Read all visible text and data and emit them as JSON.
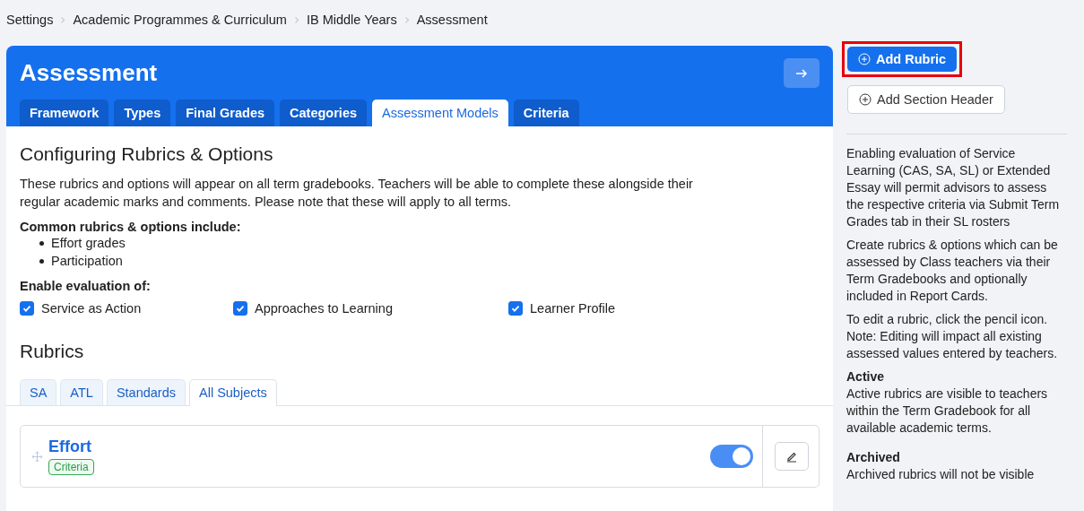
{
  "breadcrumb": [
    "Settings",
    "Academic Programmes & Curriculum",
    "IB Middle Years",
    "Assessment"
  ],
  "page": {
    "title": "Assessment",
    "tabs": [
      {
        "label": "Framework",
        "selected": false
      },
      {
        "label": "Types",
        "selected": false
      },
      {
        "label": "Final Grades",
        "selected": false
      },
      {
        "label": "Categories",
        "selected": false
      },
      {
        "label": "Assessment Models",
        "selected": true
      },
      {
        "label": "Criteria",
        "selected": false
      }
    ]
  },
  "section": {
    "heading": "Configuring Rubrics & Options",
    "intro": "These rubrics and options will appear on all term gradebooks. Teachers will be able to complete these alongside their regular academic marks and comments. Please note that these will apply to all terms.",
    "common_heading": "Common rubrics & options include:",
    "common_items": [
      "Effort grades",
      "Participation"
    ],
    "enable_heading": "Enable evaluation of:",
    "options": [
      {
        "label": "Service as Action",
        "checked": true
      },
      {
        "label": "Approaches to Learning",
        "checked": true
      },
      {
        "label": "Learner Profile",
        "checked": true
      }
    ]
  },
  "rubrics": {
    "heading": "Rubrics",
    "tabs": [
      {
        "label": "SA",
        "selected": false
      },
      {
        "label": "ATL",
        "selected": false
      },
      {
        "label": "Standards",
        "selected": false
      },
      {
        "label": "All Subjects",
        "selected": true
      }
    ],
    "items": [
      {
        "name": "Effort",
        "tag": "Criteria",
        "active": true
      }
    ]
  },
  "sidebar": {
    "buttons": [
      {
        "label": "Add Rubric",
        "kind": "primary",
        "highlighted": true
      },
      {
        "label": "Add Section Header",
        "kind": "outline",
        "highlighted": false
      }
    ],
    "notes": [
      {
        "text": "Enabling evaluation of Service Learning (CAS, SA, SL) or Extended Essay will permit advisors to assess the respective criteria via Submit Term Grades tab in their SL rosters"
      },
      {
        "text": "Create rubrics & options which can be assessed by Class teachers via their Term Gradebooks and optionally included in Report Cards."
      },
      {
        "text": "To edit a rubric, click the pencil icon. Note: Editing will impact all existing assessed values entered by teachers."
      },
      {
        "title": "Active",
        "text": "Active rubrics are visible to teachers within the Term Gradebook for all available academic terms."
      },
      {
        "title": "Archived",
        "text": "Archived rubrics will not be visible"
      }
    ]
  }
}
